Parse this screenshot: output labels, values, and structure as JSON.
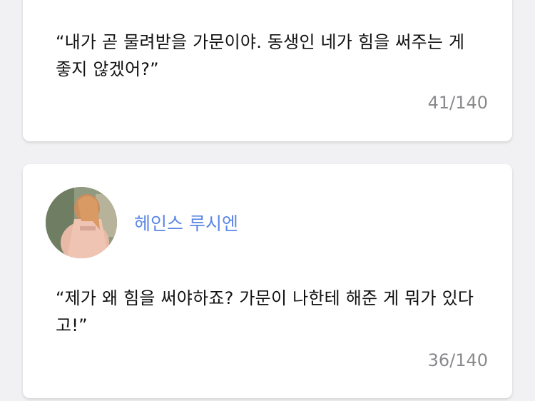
{
  "entries": [
    {
      "quote": "“내가 곧 물려받을 가문이야. 동생인 네가 힘을 써주는 게 좋지 않겠어?”",
      "counter": "41/140"
    },
    {
      "character_name": "헤인스 루시엔",
      "quote": "“제가 왜 힘을 써야하죠? 가문이 나한테 해준 게 뭐가 있다고!”",
      "counter": "36/140"
    }
  ],
  "colors": {
    "background": "#f1f1f3",
    "card": "#ffffff",
    "name_accent": "#5b86e5",
    "counter_text": "#8a8a8e"
  }
}
